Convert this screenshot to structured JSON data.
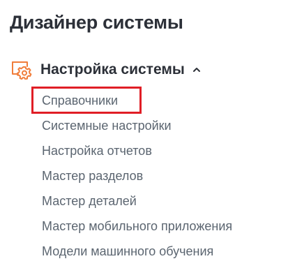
{
  "page": {
    "title": "Дизайнер системы"
  },
  "section": {
    "icon": "gear-settings-icon",
    "title": "Настройка системы",
    "expanded": true,
    "accent_color": "#f07d3a",
    "items": [
      {
        "label": "Справочники",
        "highlighted": true
      },
      {
        "label": "Системные настройки"
      },
      {
        "label": "Настройка отчетов"
      },
      {
        "label": "Мастер разделов"
      },
      {
        "label": "Мастер деталей"
      },
      {
        "label": "Мастер мобильного приложения"
      },
      {
        "label": "Модели машинного обучения"
      }
    ]
  },
  "colors": {
    "highlight": "#e01e26",
    "title_text": "#2c3038",
    "item_text": "#5b6570"
  }
}
